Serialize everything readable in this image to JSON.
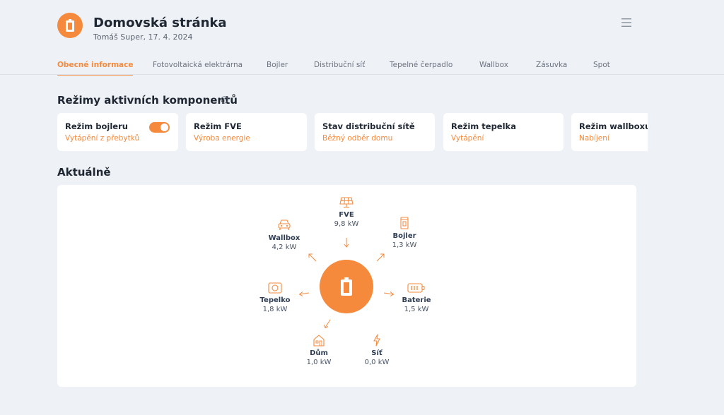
{
  "header": {
    "title": "Domovská stránka",
    "subtitle": "Tomáš Super, 17. 4. 2024"
  },
  "tabs": [
    {
      "label": "Obecné informace",
      "active": true
    },
    {
      "label": "Fotovoltaická elektrárna",
      "active": false
    },
    {
      "label": "Bojler",
      "active": false
    },
    {
      "label": "Distribuční síť",
      "active": false
    },
    {
      "label": "Tepelné čerpadlo",
      "active": false
    },
    {
      "label": "Wallbox",
      "active": false
    },
    {
      "label": "Zásuvka",
      "active": false
    },
    {
      "label": "Spot",
      "active": false
    }
  ],
  "modes": {
    "title": "Režimy aktivních komponentů",
    "cards": [
      {
        "title": "Režim bojleru",
        "value": "Vytápění z přebytků",
        "toggle": true
      },
      {
        "title": "Režim FVE",
        "value": "Výroba energie"
      },
      {
        "title": "Stav distribuční sítě",
        "value": "Běžný odběr domu"
      },
      {
        "title": "Režim tepelka",
        "value": "Vytápění"
      },
      {
        "title": "Režim wallboxu",
        "value": "Nabíjení"
      }
    ]
  },
  "current": {
    "title": "Aktuálně",
    "nodes": {
      "fve": {
        "label": "FVE",
        "value": "9,8 kW",
        "icon": "solar-panel-icon"
      },
      "bojler": {
        "label": "Bojler",
        "value": "1,3 kW",
        "icon": "boiler-icon"
      },
      "baterie": {
        "label": "Baterie",
        "value": "1,5 kW",
        "icon": "battery-icon"
      },
      "sit": {
        "label": "Síť",
        "value": "0,0 kW",
        "icon": "lightning-icon"
      },
      "dum": {
        "label": "Dům",
        "value": "1,0 kW",
        "icon": "house-icon"
      },
      "tepelko": {
        "label": "Tepelko",
        "value": "1,8 kW",
        "icon": "heat-pump-icon"
      },
      "wallbox": {
        "label": "Wallbox",
        "value": "4,2 kW",
        "icon": "car-icon"
      }
    }
  },
  "colors": {
    "accent": "#f58a3d",
    "background": "#eef1f5",
    "card": "#ffffff"
  }
}
